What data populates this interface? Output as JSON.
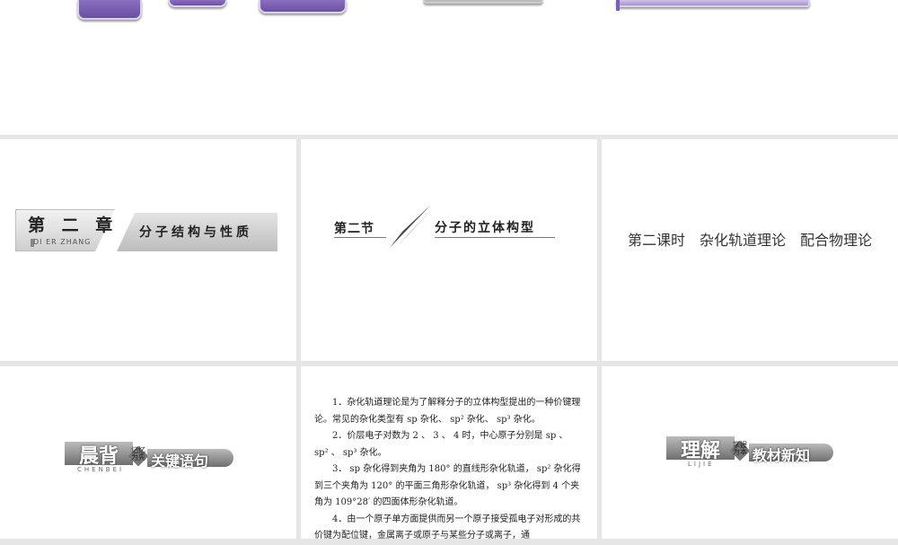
{
  "chapter": {
    "title": "第 二 章",
    "subtitle": "DI ER ZHANG",
    "name": "分子结构与性质"
  },
  "section": {
    "number": "第二节",
    "name": "分子的立体构型"
  },
  "lesson": {
    "title": "第二课时　杂化轨道理论　配合物理论"
  },
  "badge1": {
    "big": "晨背",
    "small": "记忆\n为先",
    "tail": "关键语句",
    "pinyin": "CHENBEI"
  },
  "badge2": {
    "big": "理解",
    "small": "掌握\n为本",
    "tail": "教材新知",
    "pinyin": "LIJIE"
  },
  "key_points": [
    "1．杂化轨道理论是为了解释分子的立体构型提出的一种价键理论。常见的杂化类型有 sp 杂化、 sp² 杂化、 sp³ 杂化。",
    "2．价层电子对数为 2 、 3 、 4 时，中心原子分别是 sp 、 sp² 、 sp³ 杂化。",
    "3． sp 杂化得到夹角为 180° 的直线形杂化轨道， sp² 杂化得到三个夹角为 120° 的平面三角形杂化轨道， sp³ 杂化得到 4 个夹角为 109°28′ 的四面体形杂化轨道。",
    "4．由一个原子单方面提供而另一个原子接受孤电子对形成的共价键为配位键，金属离子或原子与某些分子或离子，通"
  ]
}
